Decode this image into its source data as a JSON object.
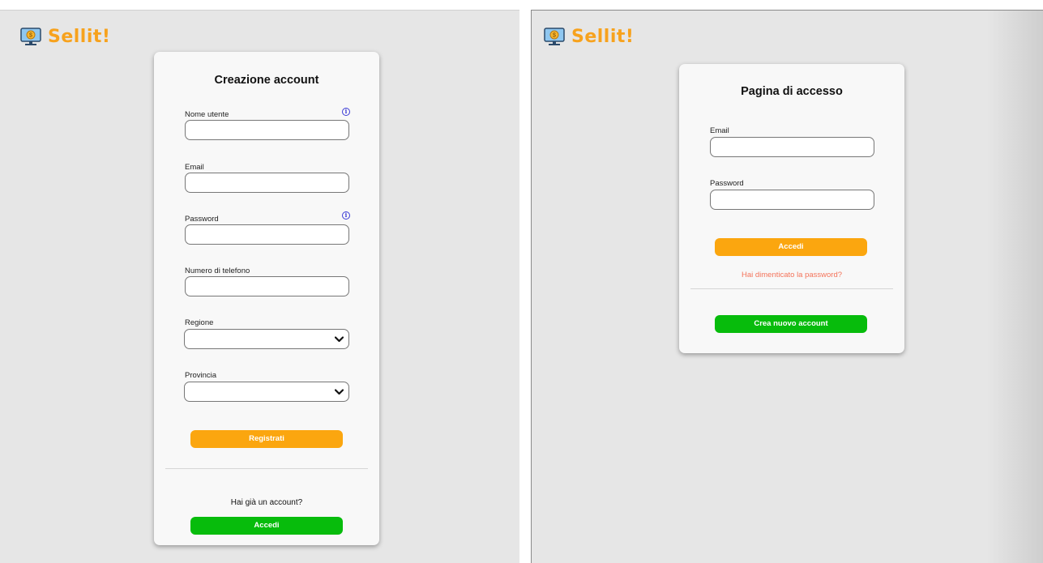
{
  "brand": {
    "name": "Sellit!",
    "color": "#f7a21d",
    "icon": "monitor-coin-icon"
  },
  "register": {
    "title": "Creazione account",
    "fields": {
      "username": {
        "label": "Nome utente",
        "value": "",
        "info_icon": "info-icon"
      },
      "email": {
        "label": "Email",
        "value": ""
      },
      "password": {
        "label": "Password",
        "value": "",
        "info_icon": "info-icon"
      },
      "phone": {
        "label": "Numero di telefono",
        "value": ""
      },
      "region": {
        "label": "Regione",
        "value": ""
      },
      "province": {
        "label": "Provincia",
        "value": ""
      }
    },
    "submit_label": "Registrati",
    "have_account_text": "Hai già un account?",
    "login_label": "Accedi"
  },
  "login": {
    "title": "Pagina di accesso",
    "fields": {
      "email": {
        "label": "Email",
        "value": ""
      },
      "password": {
        "label": "Password",
        "value": ""
      }
    },
    "submit_label": "Accedi",
    "forgot_password": "Hai dimenticato la password?",
    "create_account_label": "Crea nuovo account"
  },
  "colors": {
    "orange": "#fba60f",
    "green": "#07bc0c",
    "link": "#f4735a",
    "background": "#e6e6e6",
    "card": "#f8f8f8"
  }
}
